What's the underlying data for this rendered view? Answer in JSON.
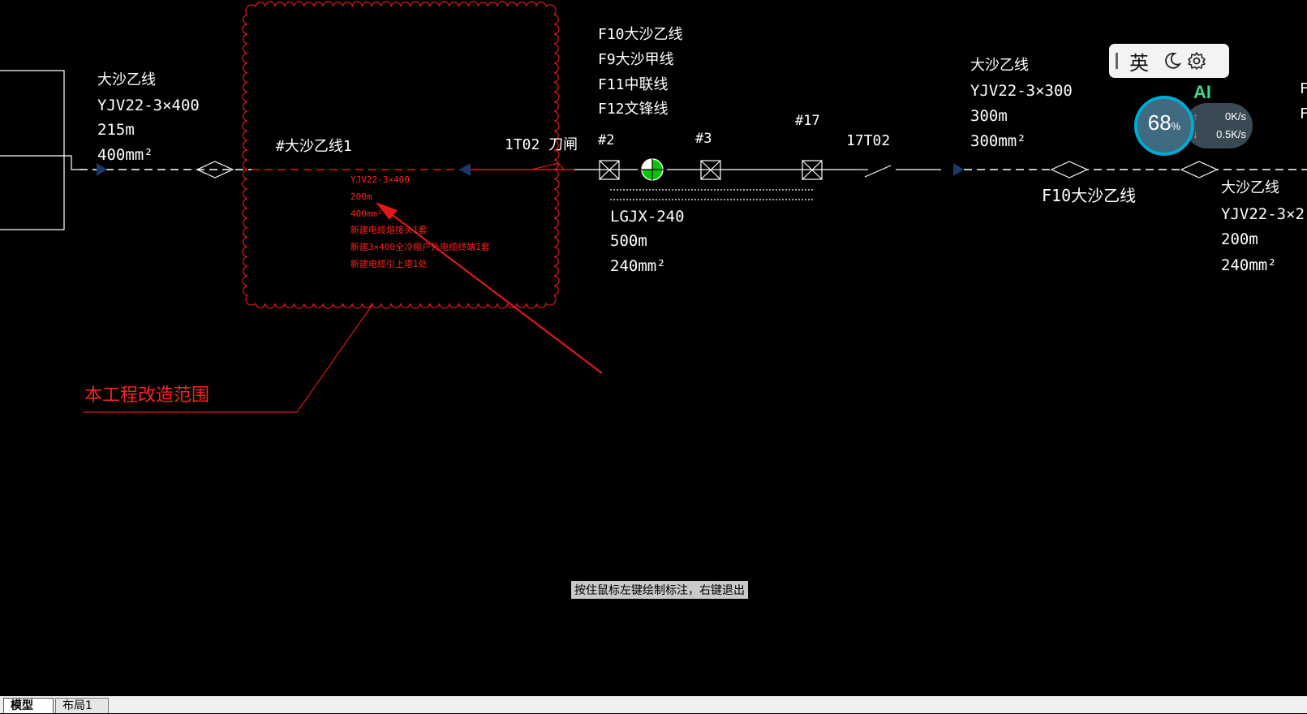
{
  "drawing": {
    "left_group": {
      "name": "大沙乙线",
      "cable": "YJV22-3×400",
      "length": "215m",
      "section": "400mm²"
    },
    "cloud_label": "#大沙乙线1",
    "red_annotation": {
      "lines": [
        "YJV22-3×400",
        "200m",
        "400mm²",
        "新建电缆熔接头1套",
        "新建3×400全冷缩户外电缆终端1套",
        "新建电缆引上塔1处"
      ]
    },
    "scope_label": "本工程改造范围",
    "switch_label": "1T02 刀闸",
    "feeder_list": [
      "F10大沙乙线",
      "F9大沙甲线",
      "F11中联线",
      "F12文锋线"
    ],
    "poles": [
      "#2",
      "#3",
      "#17"
    ],
    "overhead": {
      "cable": "LGJX-240",
      "length": "500m",
      "section": "240mm²"
    },
    "breaker_label": "17T02",
    "right_group": {
      "name": "大沙乙线",
      "cable": "YJV22-3×300",
      "length": "300m",
      "section": "300mm²"
    },
    "bottom_right_label": "F10大沙乙线",
    "far_right_group": {
      "name": "大沙乙线",
      "cable": "YJV22-3×2",
      "length": "200m",
      "section": "240mm²"
    },
    "edge_partial": [
      "F",
      "F"
    ]
  },
  "ime": {
    "lang": "英",
    "icons": [
      "moon-icon",
      "gear-icon"
    ]
  },
  "netmon": {
    "ai_badge": "AI",
    "percent": "68",
    "percent_unit": "%",
    "upload": "0K/s",
    "download": "0.5K/s"
  },
  "tooltip": "按住鼠标左键绘制标注，右键退出",
  "tabs": [
    "模型",
    "布局1"
  ],
  "colors": {
    "background": "#000000",
    "line": "#ffffff",
    "annotation": "#ff1a1a",
    "marker": "#1b3a6b"
  }
}
